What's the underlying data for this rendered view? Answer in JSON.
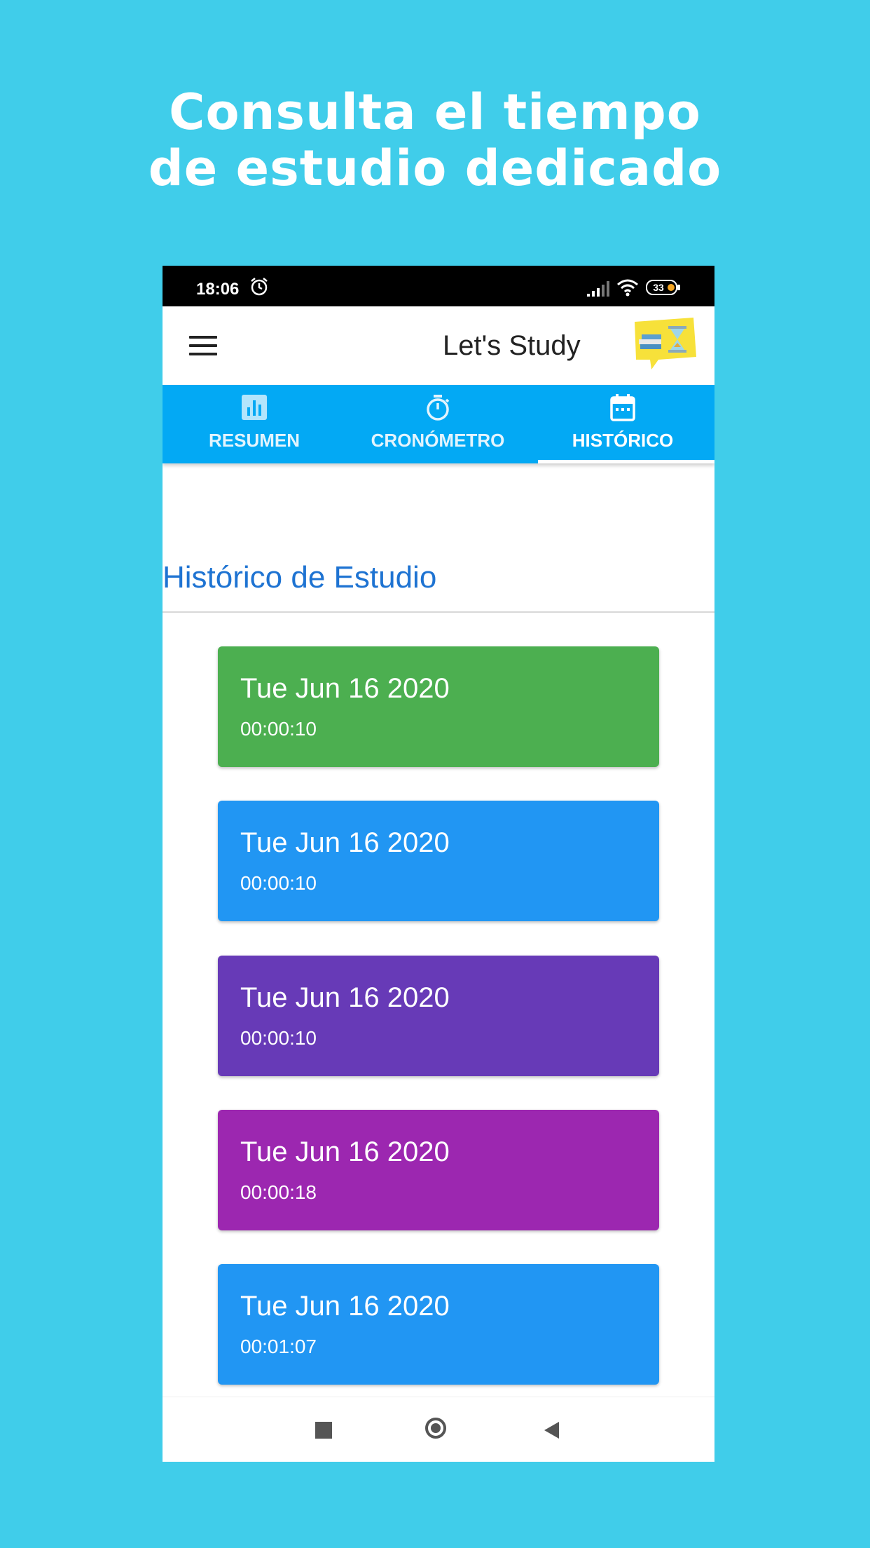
{
  "headline": {
    "line1": "Consulta el tiempo",
    "line2": "de estudio dedicado"
  },
  "status_bar": {
    "time": "18:06",
    "battery": "33"
  },
  "app_bar": {
    "title": "Let's Study"
  },
  "tabs": [
    {
      "label": "RESUMEN",
      "icon": "bar-chart-icon",
      "selected": false
    },
    {
      "label": "CRONÓMETRO",
      "icon": "stopwatch-icon",
      "selected": false
    },
    {
      "label": "HISTÓRICO",
      "icon": "calendar-icon",
      "selected": true
    }
  ],
  "section_title": "Histórico de Estudio",
  "history": [
    {
      "date": "Tue Jun 16 2020",
      "duration": "00:00:10",
      "color": "#4CAF50"
    },
    {
      "date": "Tue Jun 16 2020",
      "duration": "00:00:10",
      "color": "#2196F3"
    },
    {
      "date": "Tue Jun 16 2020",
      "duration": "00:00:10",
      "color": "#673AB7"
    },
    {
      "date": "Tue Jun 16 2020",
      "duration": "00:00:18",
      "color": "#9C27B0"
    },
    {
      "date": "Tue Jun 16 2020",
      "duration": "00:01:07",
      "color": "#2196F3"
    }
  ],
  "colors": {
    "background": "#40CDEA",
    "tab_bar": "#03A9F4",
    "section_title": "#1E73D2"
  }
}
